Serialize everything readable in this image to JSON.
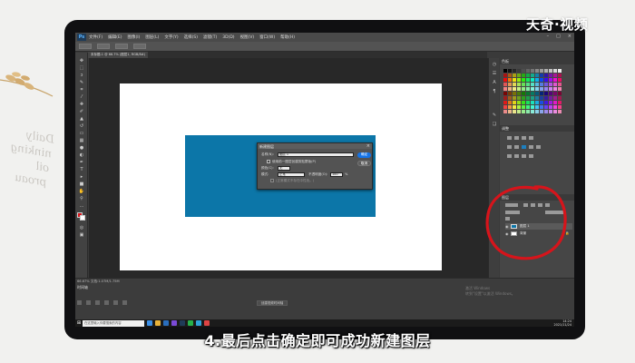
{
  "brand": {
    "logo_text": "天奇·视频"
  },
  "caption": {
    "text": "4.最后点击确定即可成功新建图层"
  },
  "photoshop": {
    "menu": [
      "文件(F)",
      "编辑(E)",
      "图像(I)",
      "图层(L)",
      "文字(Y)",
      "选择(S)",
      "滤镜(T)",
      "3D(D)",
      "视图(V)",
      "窗口(W)",
      "帮助(H)"
    ],
    "doc_tab": "未标题-1 @ 66.7% (图层1, RGB/8#)",
    "status_text": "66.67%  文档:1.07M/1.75M",
    "timeline_label": "时间轴",
    "timeline_button": "创建视频时间轴",
    "watermark_line1": "激活 Windows",
    "watermark_line2": "转到\"设置\"以激活 Windows。"
  },
  "dialog": {
    "title": "新建图层",
    "name_label": "名称(N):",
    "name_value": "图层 1",
    "ok_label": "确定",
    "cancel_label": "取消",
    "clip_label": "使用前一图层创建剪贴蒙版(P)",
    "color_label": "颜色(C):",
    "color_value": "无",
    "mode_label": "模式:",
    "mode_value": "正常",
    "opacity_label": "不透明度(O):",
    "opacity_value": "100",
    "opacity_unit": "%",
    "neutral_label": "(正常模式不存在中性色。)"
  },
  "panels": {
    "swatches_tab": "色板",
    "adjustments_tab": "调整",
    "layers_tab": "图层",
    "layers": [
      {
        "name": "图层 1",
        "selected": true,
        "thumb_color": "#0c76a8"
      },
      {
        "name": "背景",
        "selected": false,
        "thumb_color": "#ffffff"
      }
    ]
  },
  "taskbar": {
    "search_placeholder": "在这里输入你要搜索的内容",
    "time": "14:24",
    "date": "2021/11/24"
  },
  "colors": {
    "blue_rect": "#0c76a8",
    "annotation": "#d6141b"
  }
}
